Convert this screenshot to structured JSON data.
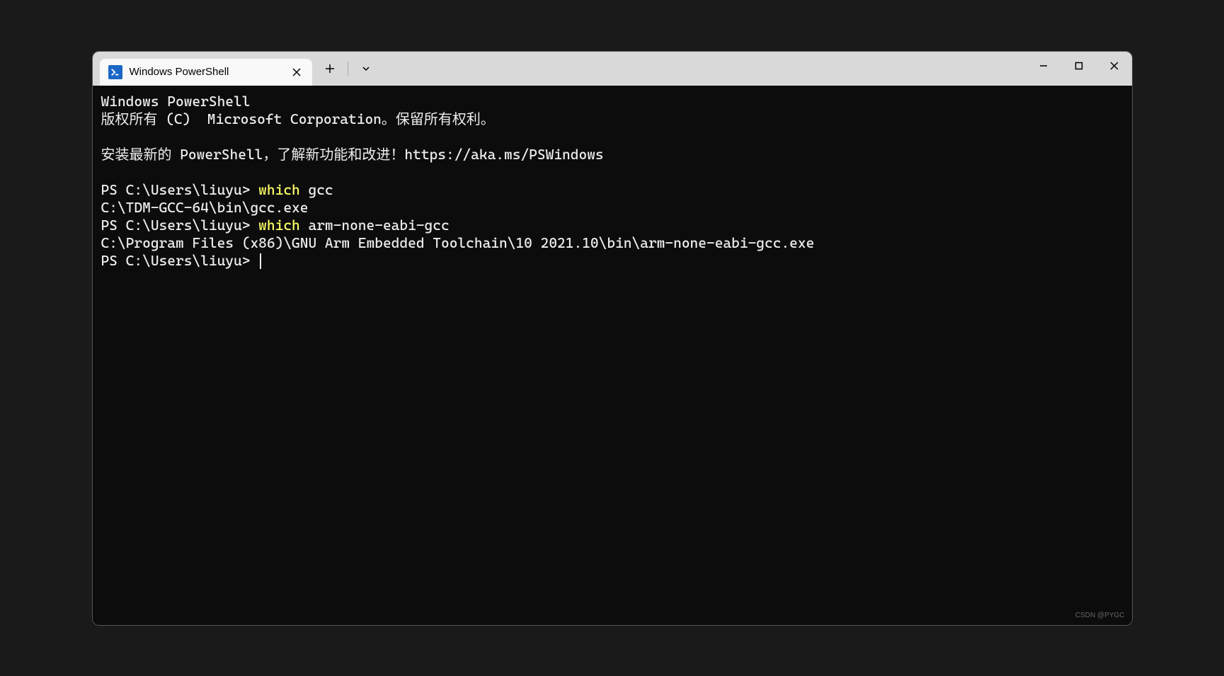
{
  "titlebar": {
    "tab": {
      "title": "Windows PowerShell",
      "icon_glyph": ">_"
    },
    "new_tab_label": "+",
    "dropdown_label": "⌄",
    "close_tab_label": "✕"
  },
  "window_controls": {
    "minimize": "—",
    "maximize": "☐",
    "close": "✕"
  },
  "terminal": {
    "header_line1": "Windows PowerShell",
    "header_line2": "版权所有 (C)  Microsoft Corporation。保留所有权利。",
    "install_line": "安装最新的 PowerShell，了解新功能和改进！https://aka.ms/PSWindows",
    "entries": [
      {
        "prompt": "PS C:\\Users\\liuyu> ",
        "cmd_keyword": "which",
        "cmd_args": " gcc",
        "output": "C:\\TDM-GCC-64\\bin\\gcc.exe"
      },
      {
        "prompt": "PS C:\\Users\\liuyu> ",
        "cmd_keyword": "which",
        "cmd_args": " arm-none-eabi-gcc",
        "output": "C:\\Program Files (x86)\\GNU Arm Embedded Toolchain\\10 2021.10\\bin\\arm-none-eabi-gcc.exe"
      }
    ],
    "final_prompt": "PS C:\\Users\\liuyu> "
  },
  "watermark": "CSDN @PYGC"
}
